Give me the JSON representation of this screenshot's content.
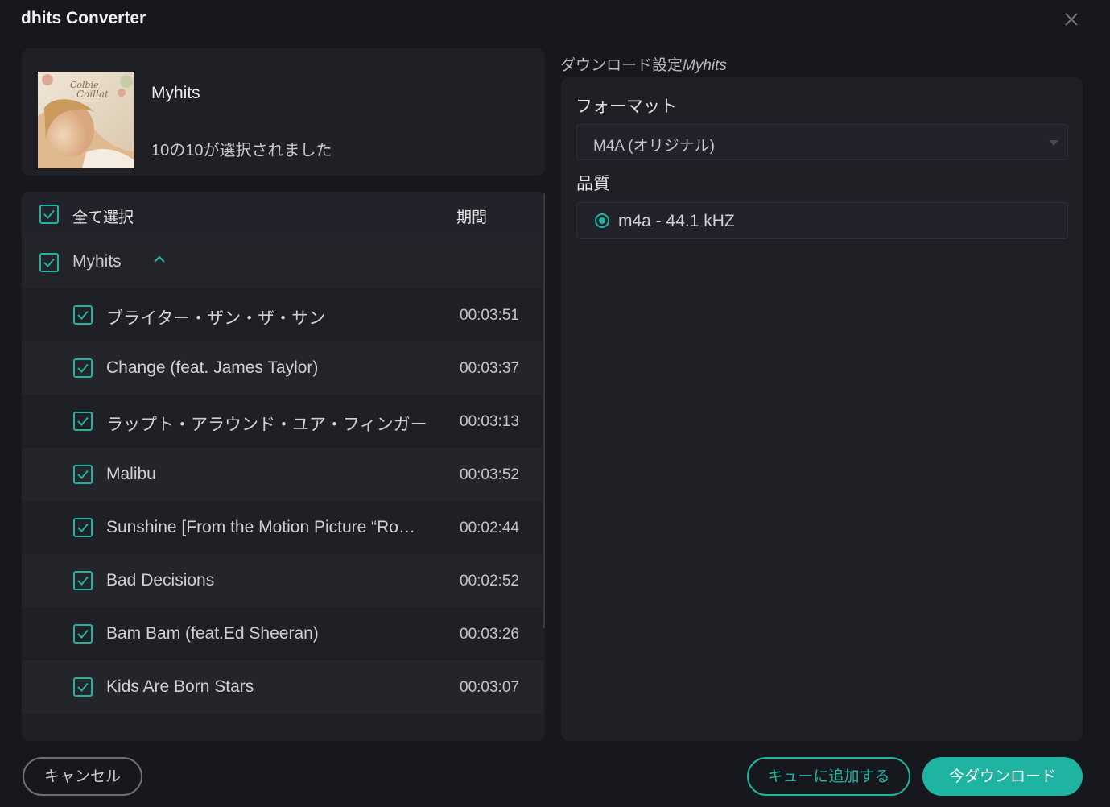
{
  "window": {
    "title": "dhits Converter"
  },
  "album": {
    "title": "Myhits",
    "selection_status": "10の10が選択されました",
    "art_lettering": "Colbie Caillat"
  },
  "list": {
    "select_all_label": "全て選択",
    "duration_header": "期間",
    "group_label": "Myhits",
    "tracks": [
      {
        "title": "ブライター・ザン・ザ・サン",
        "duration": "00:03:51"
      },
      {
        "title": "Change (feat. James Taylor)",
        "duration": "00:03:37"
      },
      {
        "title": "ラップト・アラウンド・ユア・フィンガー",
        "duration": "00:03:13"
      },
      {
        "title": "Malibu",
        "duration": "00:03:52"
      },
      {
        "title": "Sunshine [From the Motion Picture “Ro…",
        "duration": "00:02:44"
      },
      {
        "title": "Bad Decisions",
        "duration": "00:02:52"
      },
      {
        "title": "Bam Bam (feat.Ed Sheeran)",
        "duration": "00:03:26"
      },
      {
        "title": "Kids Are Born Stars",
        "duration": "00:03:07"
      }
    ]
  },
  "settings": {
    "heading_prefix": "ダウンロード設定",
    "heading_album": "Myhits",
    "format_label": "フォーマット",
    "format_value": "M4A (オリジナル)",
    "quality_label": "品質",
    "quality_value": "m4a - 44.1 kHZ"
  },
  "buttons": {
    "cancel": "キャンセル",
    "add_to_queue": "キューに追加する",
    "download_now": "今ダウンロード"
  },
  "colors": {
    "accent": "#1fb3a2",
    "background": "#17181d",
    "panel": "#1f2026"
  }
}
